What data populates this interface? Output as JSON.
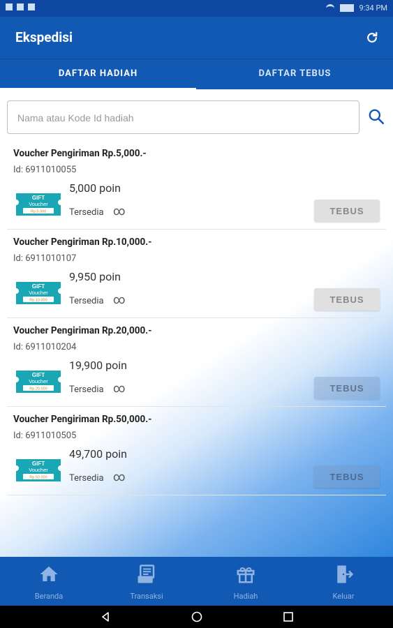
{
  "status_bar": {
    "time": "9:34 PM"
  },
  "app_bar": {
    "title": "Ekspedisi",
    "action_icon": "refresh-icon"
  },
  "tabs": [
    {
      "label": "DAFTAR HADIAH",
      "active": true
    },
    {
      "label": "DAFTAR TEBUS",
      "active": false
    }
  ],
  "search": {
    "placeholder": "Nama atau Kode Id hadiah",
    "icon": "search-icon"
  },
  "voucher_image": {
    "line1": "GIFT",
    "line2": "Voucher"
  },
  "items": [
    {
      "name": "Voucher Pengiriman Rp.5,000.-",
      "id": "Id: 6911010055",
      "points": "5,000 poin",
      "status": "Tersedia",
      "stock": "∞",
      "button": "TEBUS",
      "voucher_amount": "Rp.5.000"
    },
    {
      "name": "Voucher Pengiriman Rp.10,000.-",
      "id": "Id: 6911010107",
      "points": "9,950 poin",
      "status": "Tersedia",
      "stock": "∞",
      "button": "TEBUS",
      "voucher_amount": "Rp.10.000"
    },
    {
      "name": "Voucher Pengiriman Rp.20,000.-",
      "id": "Id: 6911010204",
      "points": "19,900 poin",
      "status": "Tersedia",
      "stock": "∞",
      "button": "TEBUS",
      "voucher_amount": "Rp.20.000"
    },
    {
      "name": "Voucher Pengiriman Rp.50,000.-",
      "id": "Id: 6911010505",
      "points": "49,700 poin",
      "status": "Tersedia",
      "stock": "∞",
      "button": "TEBUS",
      "voucher_amount": "Rp.50.000"
    }
  ],
  "bottom_nav": [
    {
      "label": "Beranda",
      "icon": "home-icon"
    },
    {
      "label": "Transaksi",
      "icon": "receipt-icon"
    },
    {
      "label": "Hadiah",
      "icon": "gift-icon"
    },
    {
      "label": "Keluar",
      "icon": "exit-icon"
    }
  ],
  "colors": {
    "primary": "#1259b3",
    "status_bar": "#0d47a1",
    "nav_label": "#8fb3e3",
    "voucher": "#1aa7b5"
  }
}
